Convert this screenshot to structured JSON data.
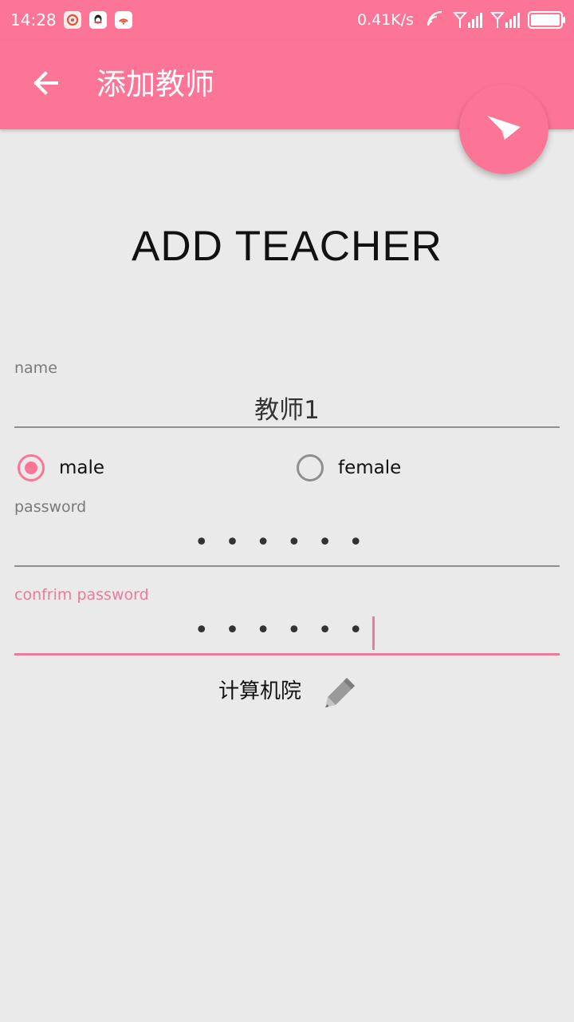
{
  "status_bar": {
    "time": "14:28",
    "net_speed": "0.41K/s",
    "notification_icons": [
      "netease-music-icon",
      "qq-icon",
      "weibo-icon"
    ],
    "battery_level": 1.0
  },
  "app_bar": {
    "title": "添加教师",
    "back_icon": "arrow-back-icon",
    "fab_icon": "send-icon"
  },
  "form": {
    "heading": "ADD TEACHER",
    "name": {
      "label": "name",
      "value": "教师1"
    },
    "gender": {
      "options": [
        {
          "label": "male",
          "checked": true
        },
        {
          "label": "female",
          "checked": false
        }
      ]
    },
    "password": {
      "label": "password",
      "value": "••••••"
    },
    "confirm_password": {
      "label": "confrim password",
      "value": "••••••"
    },
    "department": {
      "value": "计算机院",
      "icon": "pencil-edit-icon"
    }
  },
  "colors": {
    "accent": "#fd7596",
    "background": "#eaeaea"
  }
}
